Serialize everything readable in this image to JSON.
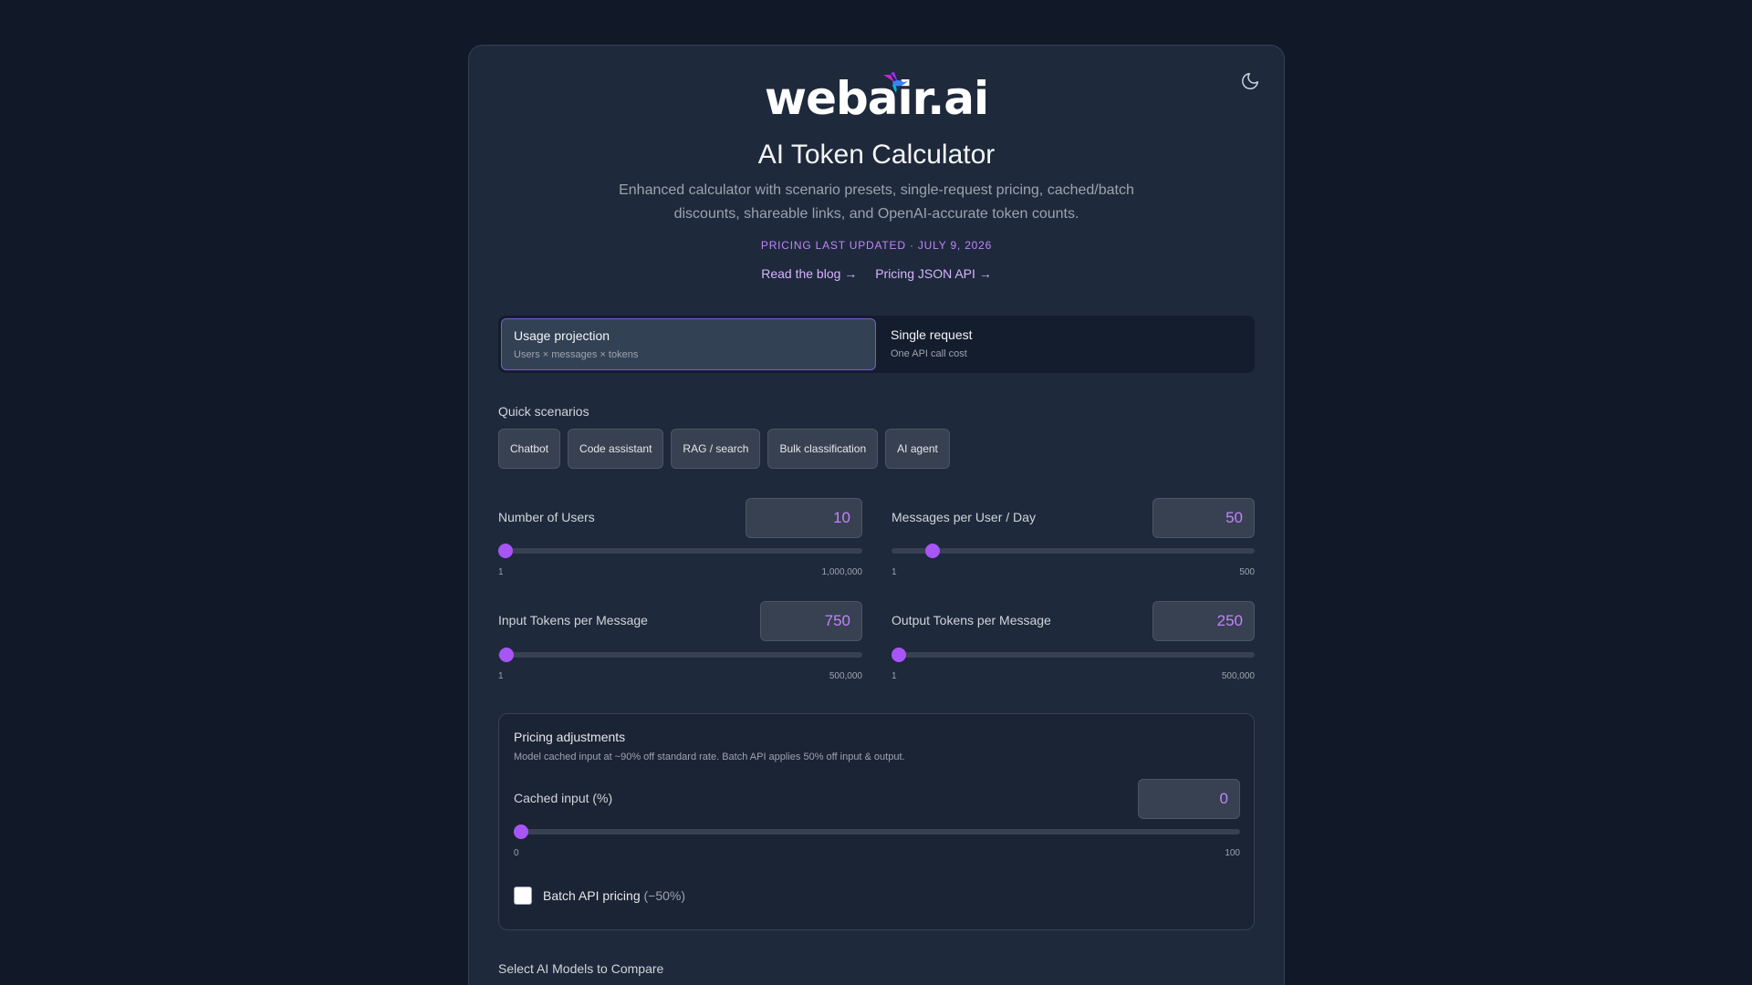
{
  "header": {
    "logo_text": "webair.ai",
    "title": "AI Token Calculator",
    "subtitle_line1": "Enhanced calculator with scenario presets, single-request pricing, cached/batch",
    "subtitle_line2": "discounts, shareable links, and OpenAI-accurate token counts.",
    "pricing_updated": "PRICING LAST UPDATED · JULY 9, 2026",
    "links": {
      "blog": "Read the blog →",
      "api": "Pricing JSON API →"
    },
    "theme_icon": "moon-icon"
  },
  "mode": {
    "options": [
      {
        "title": "Usage projection",
        "subtitle": "Users × messages × tokens",
        "active": true
      },
      {
        "title": "Single request",
        "subtitle": "One API call cost",
        "active": false
      }
    ]
  },
  "scenarios": {
    "label": "Quick scenarios",
    "items": [
      "Chatbot",
      "Code assistant",
      "RAG / search",
      "Bulk classification",
      "AI agent"
    ]
  },
  "fields": {
    "users": {
      "label": "Number of Users",
      "value": "10",
      "min": "1",
      "max": "1,000,000",
      "fraction": 0.0
    },
    "messages": {
      "label": "Messages per User / Day",
      "value": "50",
      "min": "1",
      "max": "500",
      "fraction": 0.098
    },
    "input_tokens": {
      "label": "Input Tokens per Message",
      "value": "750",
      "min": "1",
      "max": "500,000",
      "fraction": 0.0015
    },
    "output_tokens": {
      "label": "Output Tokens per Message",
      "value": "250",
      "min": "1",
      "max": "500,000",
      "fraction": 0.0005
    }
  },
  "adjustments": {
    "title": "Pricing adjustments",
    "description": "Model cached input at ~90% off standard rate. Batch API applies 50% off input & output.",
    "cached": {
      "label": "Cached input (%)",
      "value": "0",
      "min": "0",
      "max": "100",
      "fraction": 0.0
    },
    "batch_label": "Batch API pricing",
    "batch_note": "(−50%)",
    "batch_checked": false
  },
  "models": {
    "label": "Select AI Models to Compare"
  },
  "colors": {
    "accent": "#a855f7",
    "background": "#111827",
    "card": "#1e293b"
  }
}
